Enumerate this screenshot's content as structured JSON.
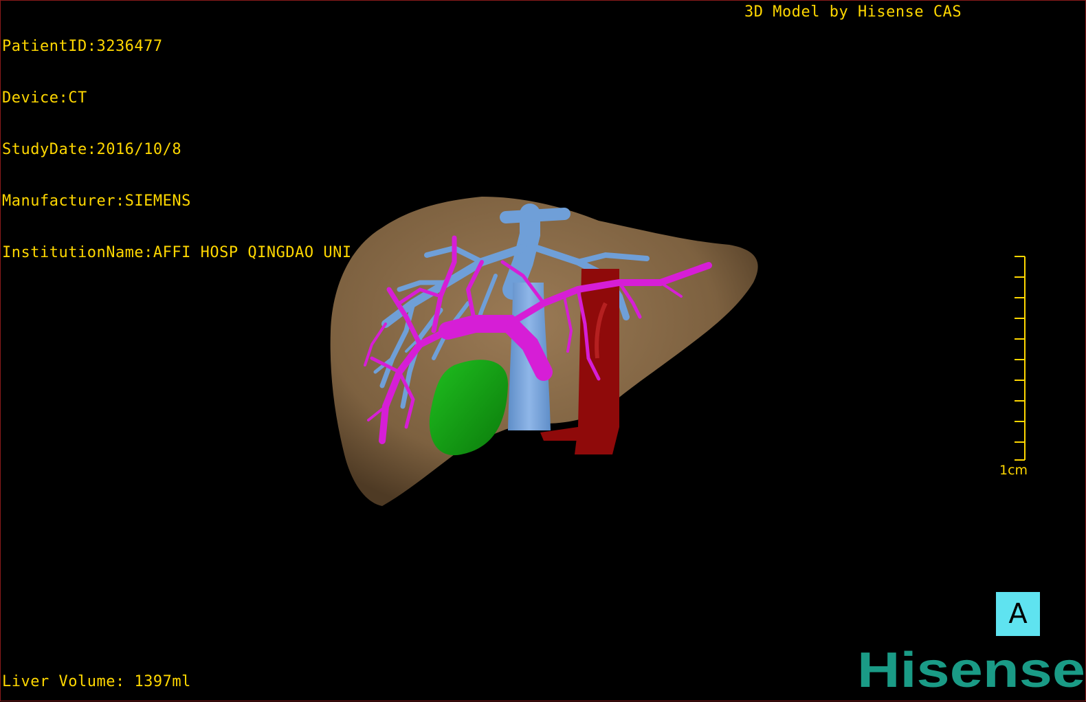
{
  "patient_info": {
    "patient_id": "PatientID:3236477",
    "device": "Device:CT",
    "study_date": "StudyDate:2016/10/8",
    "manufacturer": "Manufacturer:SIEMENS",
    "institution": "InstitutionName:AFFI HOSP QINGDAO UNI"
  },
  "model_credit": "3D Model by Hisense CAS",
  "liver_volume": "Liver Volume: 1397ml",
  "scale_bar": {
    "label": "1cm"
  },
  "orientation_button": {
    "label": "A"
  },
  "logo": {
    "text": "Hisense",
    "color": "#1a9b86"
  },
  "colors": {
    "overlay_text": "#ffd700",
    "liver": "#8b6e4e",
    "portal_vein": "#d61ed6",
    "hepatic_vein": "#6f9fd8",
    "aorta": "#8f0a0a",
    "gallbladder": "#14a014",
    "orientation_bg": "#5fe3f0",
    "frame_border": "#8a1a1a"
  }
}
